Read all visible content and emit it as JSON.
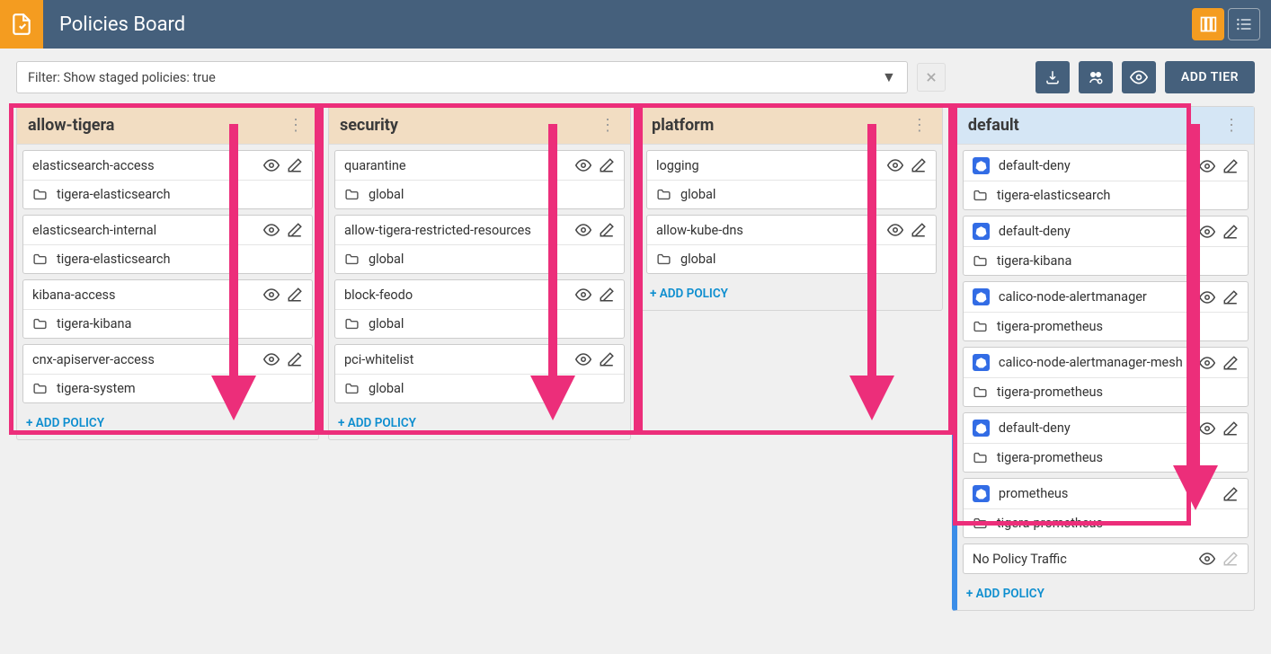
{
  "header": {
    "title": "Policies Board"
  },
  "filter": {
    "text": "Filter: Show staged policies: true",
    "clear": "×"
  },
  "buttons": {
    "add_tier": "ADD TIER"
  },
  "tiers": [
    {
      "id": "allow-tigera",
      "title": "allow-tigera",
      "default": false,
      "add_label": "+ ADD POLICY",
      "policies": [
        {
          "name": "elasticsearch-access",
          "ns": "tigera-elasticsearch",
          "icon": "folder",
          "eye": true,
          "edit": true
        },
        {
          "name": "elasticsearch-internal",
          "ns": "tigera-elasticsearch",
          "icon": "folder",
          "eye": true,
          "edit": true
        },
        {
          "name": "kibana-access",
          "ns": "tigera-kibana",
          "icon": "folder",
          "eye": true,
          "edit": true
        },
        {
          "name": "cnx-apiserver-access",
          "ns": "tigera-system",
          "icon": "folder",
          "eye": true,
          "edit": true
        }
      ]
    },
    {
      "id": "security",
      "title": "security",
      "default": false,
      "add_label": "+ ADD POLICY",
      "policies": [
        {
          "name": "quarantine",
          "ns": "global",
          "icon": "folder",
          "eye": true,
          "edit": true
        },
        {
          "name": "allow-tigera-restricted-resources",
          "ns": "global",
          "icon": "folder",
          "eye": true,
          "edit": true
        },
        {
          "name": "block-feodo",
          "ns": "global",
          "icon": "folder",
          "eye": true,
          "edit": true
        },
        {
          "name": "pci-whitelist",
          "ns": "global",
          "icon": "folder",
          "eye": true,
          "edit": true
        }
      ]
    },
    {
      "id": "platform",
      "title": "platform",
      "default": false,
      "add_label": "+ ADD POLICY",
      "policies": [
        {
          "name": "logging",
          "ns": "global",
          "icon": "folder",
          "eye": true,
          "edit": true
        },
        {
          "name": "allow-kube-dns",
          "ns": "global",
          "icon": "folder",
          "eye": true,
          "edit": true
        }
      ]
    },
    {
      "id": "default",
      "title": "default",
      "default": true,
      "add_label": "+ ADD POLICY",
      "policies": [
        {
          "name": "default-deny",
          "ns": "tigera-elasticsearch",
          "icon": "k8s",
          "eye": true,
          "edit": true
        },
        {
          "name": "default-deny",
          "ns": "tigera-kibana",
          "icon": "k8s",
          "eye": true,
          "edit": true
        },
        {
          "name": "calico-node-alertmanager",
          "ns": "tigera-prometheus",
          "icon": "k8s",
          "eye": true,
          "edit": true
        },
        {
          "name": "calico-node-alertmanager-mesh",
          "ns": "tigera-prometheus",
          "icon": "k8s",
          "eye": true,
          "edit": true
        },
        {
          "name": "default-deny",
          "ns": "tigera-prometheus",
          "icon": "k8s",
          "eye": true,
          "edit": true
        },
        {
          "name": "prometheus",
          "ns": "tigera-prometheus",
          "icon": "k8s",
          "eye": false,
          "edit": true
        },
        {
          "name": "No Policy Traffic",
          "ns": null,
          "icon": null,
          "eye": true,
          "edit": false,
          "single_row": true
        }
      ]
    }
  ]
}
